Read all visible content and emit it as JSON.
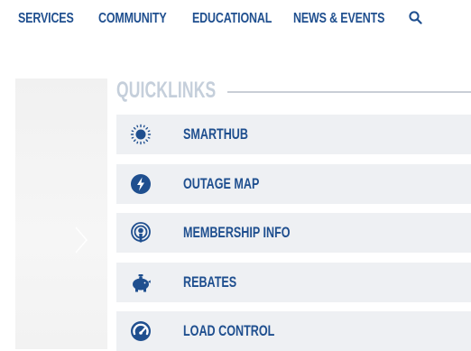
{
  "nav": {
    "items": [
      "SERVICES",
      "COMMUNITY",
      "EDUCATIONAL",
      "NEWS & EVENTS"
    ],
    "search_icon": "search-icon"
  },
  "quicklinks": {
    "heading": "QUICKLINKS",
    "items": [
      {
        "label": "SMARTHUB",
        "icon": "sun-icon"
      },
      {
        "label": "OUTAGE MAP",
        "icon": "lightning-bolt-icon"
      },
      {
        "label": "MEMBERSHIP INFO",
        "icon": "broadcast-icon"
      },
      {
        "label": "REBATES",
        "icon": "piggy-bank-icon"
      },
      {
        "label": "LOAD CONTROL",
        "icon": "gauge-icon"
      }
    ]
  },
  "colors": {
    "brand_blue": "#1f4f8f",
    "heading_gray": "#c5cfdb",
    "row_bg": "#eef0f3"
  },
  "slider": {
    "next_icon": "chevron-right-icon"
  }
}
